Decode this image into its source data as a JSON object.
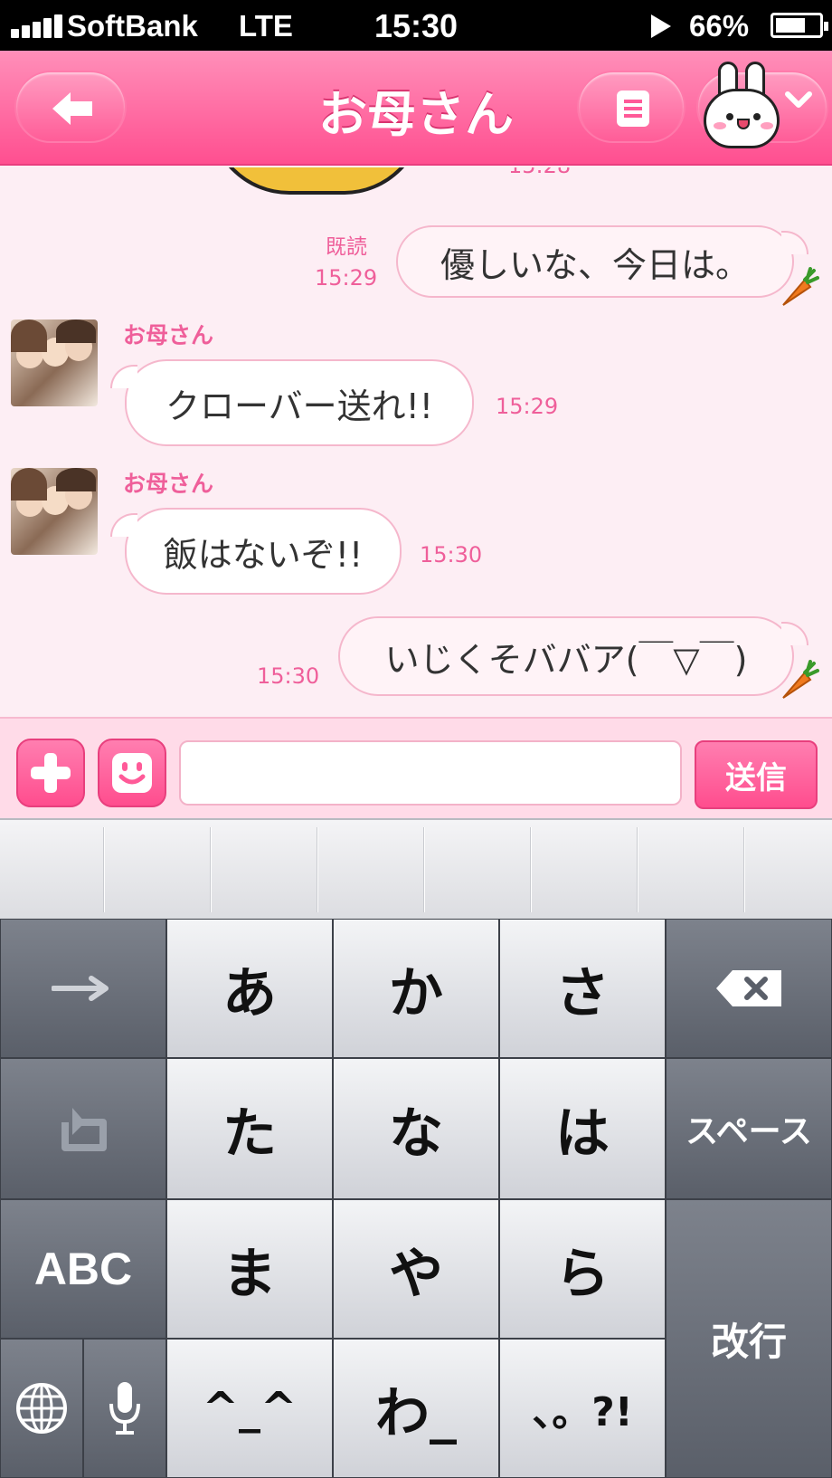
{
  "status_bar": {
    "carrier": "SoftBank",
    "network": "LTE",
    "time": "15:30",
    "battery": "66%"
  },
  "header": {
    "title": "お母さん"
  },
  "chat": {
    "partial_time": "15:28",
    "messages": [
      {
        "side": "out",
        "text": "優しいな、今日は。",
        "read": "既読",
        "time": "15:29"
      },
      {
        "side": "in",
        "sender": "お母さん",
        "text": "クローバー送れ!!",
        "time": "15:29"
      },
      {
        "side": "in",
        "sender": "お母さん",
        "text": "飯はないぞ!!",
        "time": "15:30"
      },
      {
        "side": "out",
        "text": "いじくそババア(￣▽￣)",
        "time": "15:30"
      }
    ]
  },
  "input_bar": {
    "message_value": "",
    "send_label": "送信"
  },
  "keyboard": {
    "keys": {
      "a": "あ",
      "ka": "か",
      "sa": "さ",
      "ta": "た",
      "na": "な",
      "ha": "は",
      "ma": "ま",
      "ya": "や",
      "ra": "ら",
      "kaomoji": "^_^",
      "wa": "わ_",
      "punct": "、。?!",
      "space": "スペース",
      "abc": "ABC",
      "enter": "改行"
    }
  },
  "colors": {
    "header_pink": "#ff5a98",
    "timestamp_pink": "#ef5f9a",
    "chat_bg": "#fdeef4"
  }
}
